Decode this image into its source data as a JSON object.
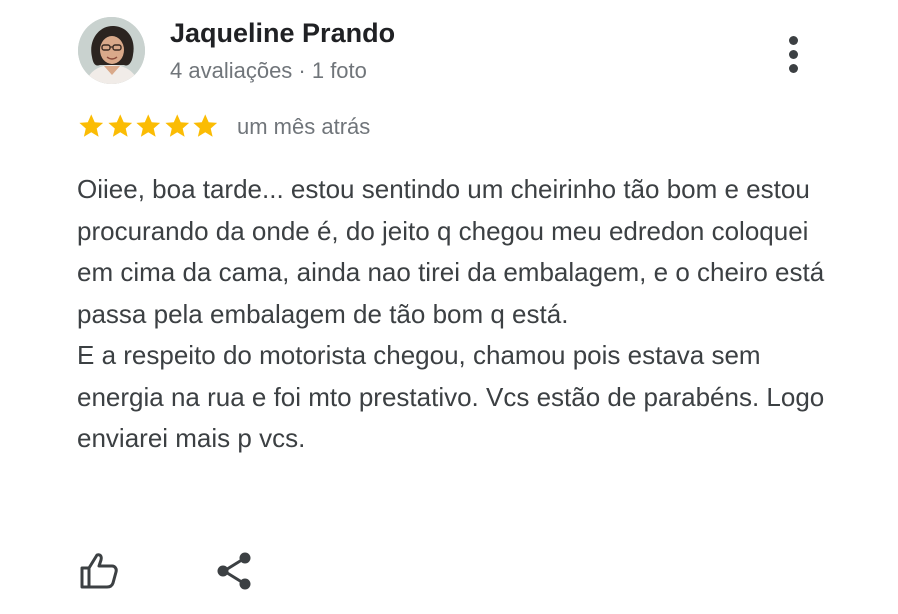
{
  "review": {
    "author": {
      "name": "Jaqueline Prando",
      "meta": "4 avaliações · 1 foto"
    },
    "rating": 5,
    "rating_color": "#fbbc04",
    "date": "um mês atrás",
    "text": {
      "paragraph_1": "Oiiee, boa tarde... estou sentindo um cheirinho tão bom e estou procurando da onde é, do jeito q chegou meu edredon coloquei em cima da cama, ainda nao tirei da embalagem, e o cheiro está passa pela embalagem de tão bom q está.",
      "paragraph_2": "E a respeito do motorista chegou, chamou pois estava sem energia na rua e foi mto prestativo. Vcs estão de parabéns. Logo enviarei mais p vcs."
    },
    "actions": {
      "like_icon": "thumb-up-icon",
      "share_icon": "share-icon",
      "menu_icon": "more-vert-icon"
    }
  }
}
